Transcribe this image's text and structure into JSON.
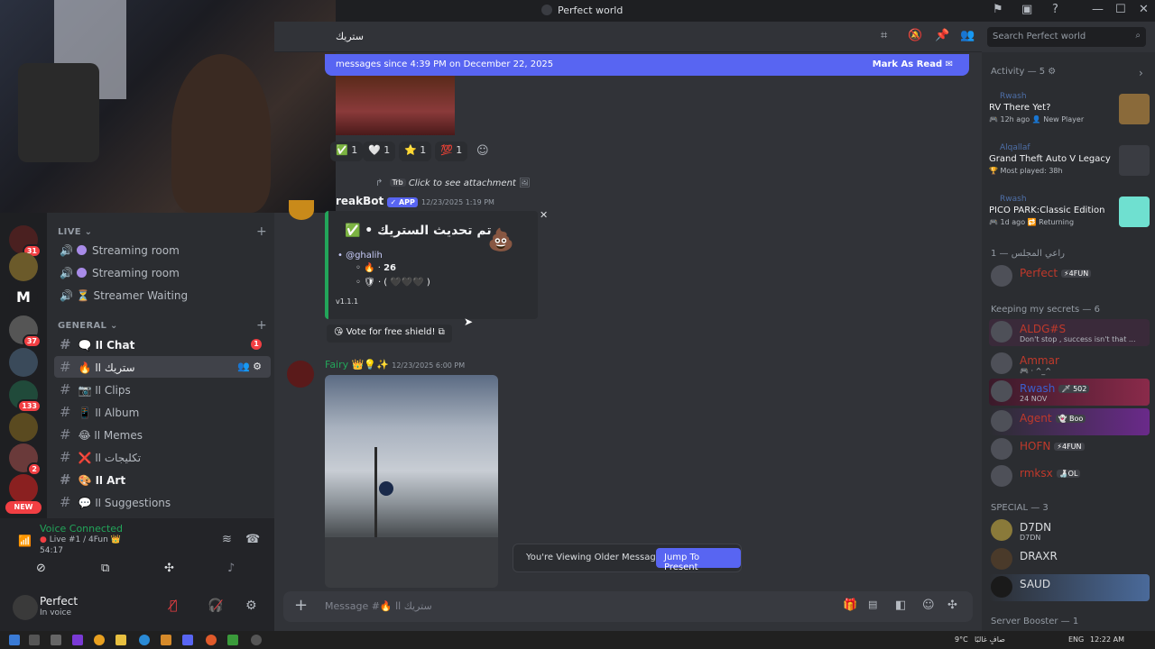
{
  "window": {
    "title": "Perfect world",
    "minimize": "—",
    "maximize": "☐",
    "close": "✕"
  },
  "colors": {
    "accent": "#5865f2",
    "green": "#23a55a",
    "red": "#f23f43",
    "bg": "#313338"
  },
  "servers": {
    "badges": [
      "31",
      "37",
      "133",
      "2"
    ],
    "new_label": "NEW"
  },
  "channels": {
    "live_category": "LIVE",
    "live": [
      "Streaming room",
      "Streaming room",
      "⏳ Streamer Waiting"
    ],
    "general_category": "GENERAL",
    "text": [
      {
        "label": "🗨️ اا Chat",
        "badge": "1"
      },
      {
        "label": "🔥 ستريك اا"
      },
      {
        "label": "📷 اا Clips"
      },
      {
        "label": "📱 اا Album"
      },
      {
        "label": "😂 اا Memes"
      },
      {
        "label": "❌ تكليجات اا"
      },
      {
        "label": "🎨 اا Art"
      },
      {
        "label": "💬 اا Suggestions"
      }
    ]
  },
  "voice": {
    "status": "Voice Connected",
    "room": "Live #1 / 4Fun 👑",
    "timer": "54:17"
  },
  "user": {
    "name": "Perfect",
    "status": "In voice"
  },
  "chat": {
    "header": "ستريك",
    "new_banner": "messages since 4:39 PM on December 22, 2025",
    "mark_read": "Mark As Read",
    "reactions": [
      "✅ 1",
      "🤍 1",
      "⭐ 1",
      "💯 1"
    ],
    "reply_preview": {
      "tag": "Trb",
      "text": "Click to see attachment"
    },
    "bot": {
      "name": "reakBot",
      "app": "✓ APP",
      "time": "12/23/2025 1:19 PM",
      "embed_title": "تم تحديث الستريك • ✅",
      "mention": "@ghalih",
      "line1": "26",
      "line2": "· ( 🖤🖤🖤 )",
      "version": "v1.1.1",
      "close": "✕"
    },
    "vote": "Vote for free shield!",
    "fairy": {
      "name": "Fairy",
      "time": "12/23/2025 6:00 PM"
    },
    "viewing": "You're Viewing Older Messages",
    "jump": "Jump To Present",
    "composer_placeholder": "Message #🔥 ستريك اا"
  },
  "members": {
    "search_placeholder": "Search Perfect world",
    "activity_header": "Activity — 5",
    "activities": [
      {
        "who": "Rwash",
        "game": "RV There Yet?",
        "meta": "🎮 12h ago   👤 New Player",
        "thumb": "#8a6a3a"
      },
      {
        "who": "Alqallaf",
        "game": "Grand Theft Auto V Legacy",
        "meta": "🏆 Most played: 38h",
        "thumb": "#3a3c42"
      },
      {
        "who": "Rwash",
        "game": "PICO PARK:Classic Edition",
        "meta": "🎮 1d ago   🔁 Returning",
        "thumb": "#6fe0d0"
      }
    ],
    "cat1": "راعي المجلس — 1",
    "owner": {
      "name": "Perfect",
      "tag": "⚡4FUN"
    },
    "cat2": "Keeping my secrets — 6",
    "secrets": [
      {
        "name": "ALDG#S",
        "sub": "Don't stop , success isn't that ...",
        "color": "#c0392b"
      },
      {
        "name": "Ammar",
        "sub": "🎮 · ^_^",
        "color": "#c0392b"
      },
      {
        "name": "Rwash",
        "sub": "24 NOV",
        "tag": "🗡 502",
        "color": "#3a5fcd"
      },
      {
        "name": "Agent",
        "tag": "👻 Boo",
        "color": "#c0392b"
      },
      {
        "name": "HOFN",
        "tag": "⚡4FUN",
        "color": "#c0392b"
      },
      {
        "name": "rmksx",
        "tag": "🍶OL",
        "color": "#c0392b"
      }
    ],
    "cat3": "SPECIAL — 3",
    "special": [
      {
        "name": "D7DN",
        "sub": "D7DN"
      },
      {
        "name": "DRAXR"
      },
      {
        "name": "SAUD"
      }
    ],
    "cat4": "Server Booster — 1"
  },
  "taskbar": {
    "weather": "9°C",
    "weather_text": "صافٍ غالبًا",
    "lang": "ENG",
    "time": "12:22 AM"
  }
}
